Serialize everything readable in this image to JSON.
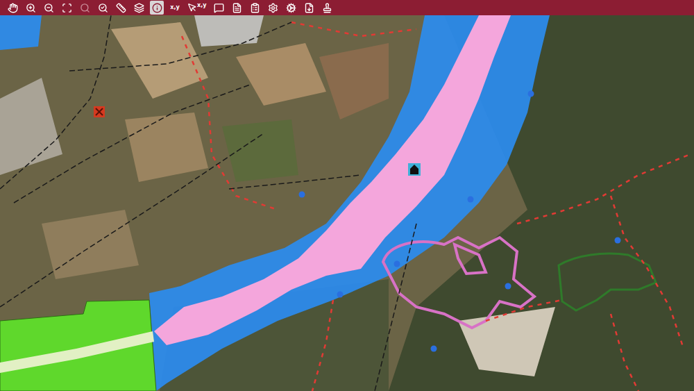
{
  "toolbar": {
    "tools": [
      {
        "kind": "icon",
        "selected": false,
        "disabled": false
      },
      {
        "kind": "icon",
        "selected": false,
        "disabled": false
      },
      {
        "kind": "icon",
        "selected": false,
        "disabled": false
      },
      {
        "kind": "icon",
        "selected": false,
        "disabled": false
      },
      {
        "kind": "icon",
        "selected": false,
        "disabled": true
      },
      {
        "kind": "icon",
        "selected": false,
        "disabled": false
      },
      {
        "kind": "icon",
        "selected": false,
        "disabled": false
      },
      {
        "kind": "icon",
        "selected": false,
        "disabled": false
      },
      {
        "kind": "icon",
        "selected": true,
        "disabled": false
      },
      {
        "kind": "text",
        "label": "x,y",
        "selected": false,
        "disabled": false
      },
      {
        "kind": "pointer-text",
        "label": "x,y",
        "selected": false,
        "disabled": false
      },
      {
        "kind": "icon",
        "selected": false,
        "disabled": false
      },
      {
        "kind": "icon",
        "selected": false,
        "disabled": false
      },
      {
        "kind": "icon",
        "selected": false,
        "disabled": false
      },
      {
        "kind": "icon",
        "selected": false,
        "disabled": false
      },
      {
        "kind": "icon",
        "selected": false,
        "disabled": false
      },
      {
        "kind": "icon",
        "selected": false,
        "disabled": false
      },
      {
        "kind": "icon",
        "selected": false,
        "disabled": false
      }
    ]
  },
  "map": {
    "layers": [
      {
        "kind": "flood-zone",
        "color": "#2b8cf0"
      },
      {
        "kind": "flood-channel",
        "color": "#f4a6dc"
      },
      {
        "kind": "land-use",
        "color": "#5fd82c"
      },
      {
        "kind": "land-use-strip",
        "color": "#e2f0c4"
      },
      {
        "kind": "settlement-outline-a",
        "color": "#d872c6"
      },
      {
        "kind": "settlement-outline-b",
        "color": "#2f7a2a"
      },
      {
        "kind": "trail",
        "color": "#e23a34"
      },
      {
        "kind": "road",
        "color": "#1a1a1a"
      },
      {
        "kind": "pin",
        "color": "#2a6fe0"
      },
      {
        "kind": "landmark",
        "color": "#111111"
      },
      {
        "kind": "marker",
        "color": "#d6391f"
      }
    ]
  }
}
